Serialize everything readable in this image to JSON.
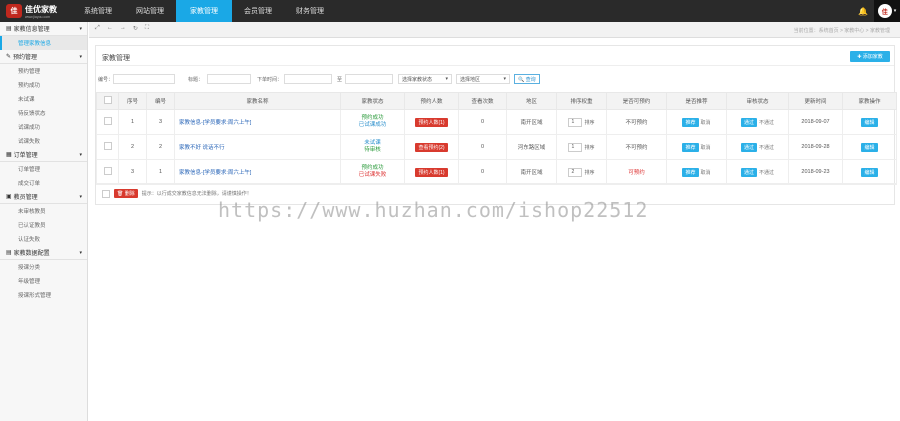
{
  "app": {
    "logo_mark": "佳",
    "logo_text": "佳优家教",
    "logo_sub": "www.jiayou.com"
  },
  "nav": [
    {
      "label": "系统管理",
      "active": false
    },
    {
      "label": "网站管理",
      "active": false
    },
    {
      "label": "家教管理",
      "active": true
    },
    {
      "label": "会员管理",
      "active": false
    },
    {
      "label": "财务管理",
      "active": false
    }
  ],
  "topbar": {
    "bell_icon": "🔔",
    "avatar_text": "佳",
    "caret": "▾"
  },
  "sidebar": {
    "groups": [
      {
        "title": "家教信息管理",
        "icon": "▤",
        "items": [
          {
            "label": "管理家教信息",
            "active": true
          }
        ]
      },
      {
        "title": "预约管理",
        "icon": "✎",
        "items": [
          {
            "label": "预约管理",
            "active": false
          },
          {
            "label": "预约成功",
            "active": false
          },
          {
            "label": "未试课",
            "active": false
          },
          {
            "label": "待反馈状态",
            "active": false
          },
          {
            "label": "试课成功",
            "active": false
          },
          {
            "label": "试课失败",
            "active": false
          }
        ]
      },
      {
        "title": "订单管理",
        "icon": "▦",
        "items": [
          {
            "label": "订单管理",
            "active": false
          },
          {
            "label": "成交订单",
            "active": false
          }
        ]
      },
      {
        "title": "教员管理",
        "icon": "▣",
        "items": [
          {
            "label": "未审核教员",
            "active": false
          },
          {
            "label": "已认证教员",
            "active": false
          },
          {
            "label": "认证失败",
            "active": false
          }
        ]
      },
      {
        "title": "家教数据配置",
        "icon": "▤",
        "items": [
          {
            "label": "授课分类",
            "active": false
          },
          {
            "label": "年级管理",
            "active": false
          },
          {
            "label": "授课形式管理",
            "active": false
          }
        ]
      }
    ]
  },
  "toolstrip": {
    "tools": [
      "⤢",
      "←",
      "→",
      "↻",
      "⛶"
    ],
    "breadcrumb": "当前位置：系统首页 > 家教中心 > 家教管理"
  },
  "panel": {
    "title": "家教管理",
    "add_label": "✚ 添加家教"
  },
  "filter": {
    "id_label": "编号：",
    "title_label": "标题：",
    "time_label": "下单时间：",
    "to_label": "至",
    "status_select": "选择家教状态",
    "area_select": "选择地区",
    "search_label": "🔍 查询"
  },
  "table": {
    "headers": [
      "",
      "序号",
      "编号",
      "家教名称",
      "家教状态",
      "预约人数",
      "查看次数",
      "地区",
      "排序权重",
      "是否可预约",
      "是否推荐",
      "审核状态",
      "更新时间",
      "家教操作"
    ],
    "rows": [
      {
        "seq": "1",
        "id": "3",
        "name": "家教信息-[学员要求:周六上午]",
        "status1": "预约成功",
        "status2": "已试课成功",
        "status_style": "green",
        "appoint": "预约人数(1)",
        "views": "0",
        "area": "南开区域",
        "order": "1",
        "order_label": "排序",
        "bookable": "不可预约",
        "bookable_red": false,
        "rec_on": "推荐",
        "rec_off": "取消",
        "audit_on": "通过",
        "audit_off": "不通过",
        "time": "2018-09-07",
        "op": "编辑"
      },
      {
        "seq": "2",
        "id": "2",
        "name": "家教不好 说话不行",
        "status1": "未试课",
        "status2": "待审核",
        "status_style": "blue",
        "appoint": "查看预约(2)",
        "views": "0",
        "area": "河东路区域",
        "order": "1",
        "order_label": "排序",
        "bookable": "不可预约",
        "bookable_red": false,
        "rec_on": "推荐",
        "rec_off": "取消",
        "audit_on": "通过",
        "audit_off": "不通过",
        "time": "2018-09-28",
        "op": "编辑"
      },
      {
        "seq": "3",
        "id": "1",
        "name": "家教信息-[学员要求:周六上午]",
        "status1": "预约成功",
        "status2": "已试课失败",
        "status_style": "red",
        "appoint": "预约人数(1)",
        "views": "0",
        "area": "南开区域",
        "order": "2",
        "order_label": "排序",
        "bookable": "可预约",
        "bookable_red": true,
        "rec_on": "推荐",
        "rec_off": "取消",
        "audit_on": "通过",
        "audit_off": "不通过",
        "time": "2018-09-23",
        "op": "编辑"
      }
    ]
  },
  "footer": {
    "delete_label": "🗑 删除",
    "tip": "提示：以行成交家教信息无法删除，请谨慎操作！"
  },
  "watermark": "https://www.huzhan.com/ishop22512"
}
